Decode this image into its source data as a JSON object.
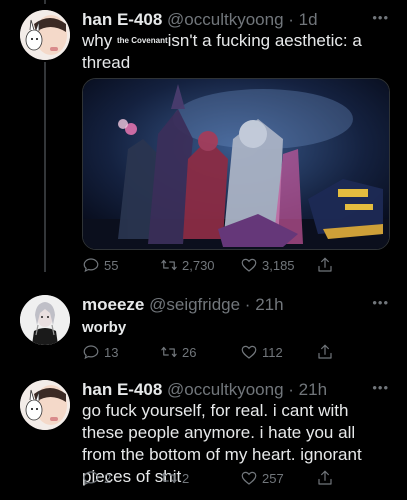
{
  "tweets": [
    {
      "display_name": "han E-408",
      "handle": "@occultkyoong",
      "time": "1d",
      "text_before": "why ",
      "inline_tag": "the Covenant",
      "text_after": "isn't a fucking aesthetic: a thread",
      "replies": "55",
      "retweets": "2,730",
      "likes": "3,185"
    },
    {
      "display_name": "moeeze",
      "handle": "@seigfridge",
      "time": "21h",
      "text": "worby",
      "replies": "13",
      "retweets": "26",
      "likes": "112"
    },
    {
      "display_name": "han E-408",
      "handle": "@occultkyoong",
      "time": "21h",
      "text": "go fuck yourself, for real. i cant with these people anymore. i hate you all from the bottom of my heart. ignorant pieces of shit",
      "replies": "2",
      "retweets": "2",
      "likes": "257"
    }
  ],
  "colors": {
    "background": "#000000",
    "text": "#e7e9ea",
    "muted": "#71767b",
    "thread_line": "#333639"
  },
  "icons": [
    "reply-icon",
    "retweet-icon",
    "like-icon",
    "share-icon",
    "more-icon"
  ]
}
